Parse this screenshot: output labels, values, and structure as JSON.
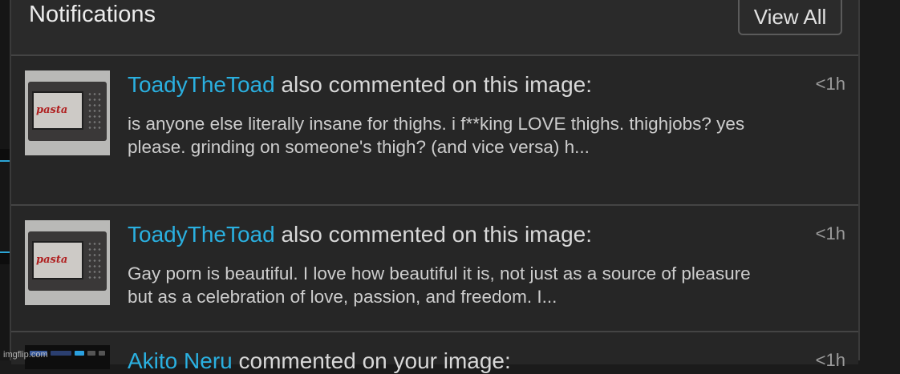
{
  "header": {
    "title": "Notifications",
    "view_all_label": "View All"
  },
  "notifications": [
    {
      "username": "ToadyTheToad",
      "action": " also commented on this image:",
      "time": "<1h",
      "preview": "is anyone else literally insane for thighs. i f**king LOVE thighs. thighjobs? yes please. grinding on someone's thigh? (and vice versa) h...",
      "thumb_label": "pasta"
    },
    {
      "username": "ToadyTheToad",
      "action": " also commented on this image:",
      "time": "<1h",
      "preview": "Gay porn is beautiful. I love how beautiful it is, not just as a source of pleasure but as a celebration of love, passion, and freedom. I...",
      "thumb_label": "pasta"
    },
    {
      "username": "Akito Neru",
      "action": " commented on your image:",
      "time": "<1h"
    }
  ],
  "watermark": "imgflip.com",
  "colors": {
    "username": "#2ab0e0",
    "panel_bg": "#262626",
    "page_bg": "#1b1b1b"
  }
}
